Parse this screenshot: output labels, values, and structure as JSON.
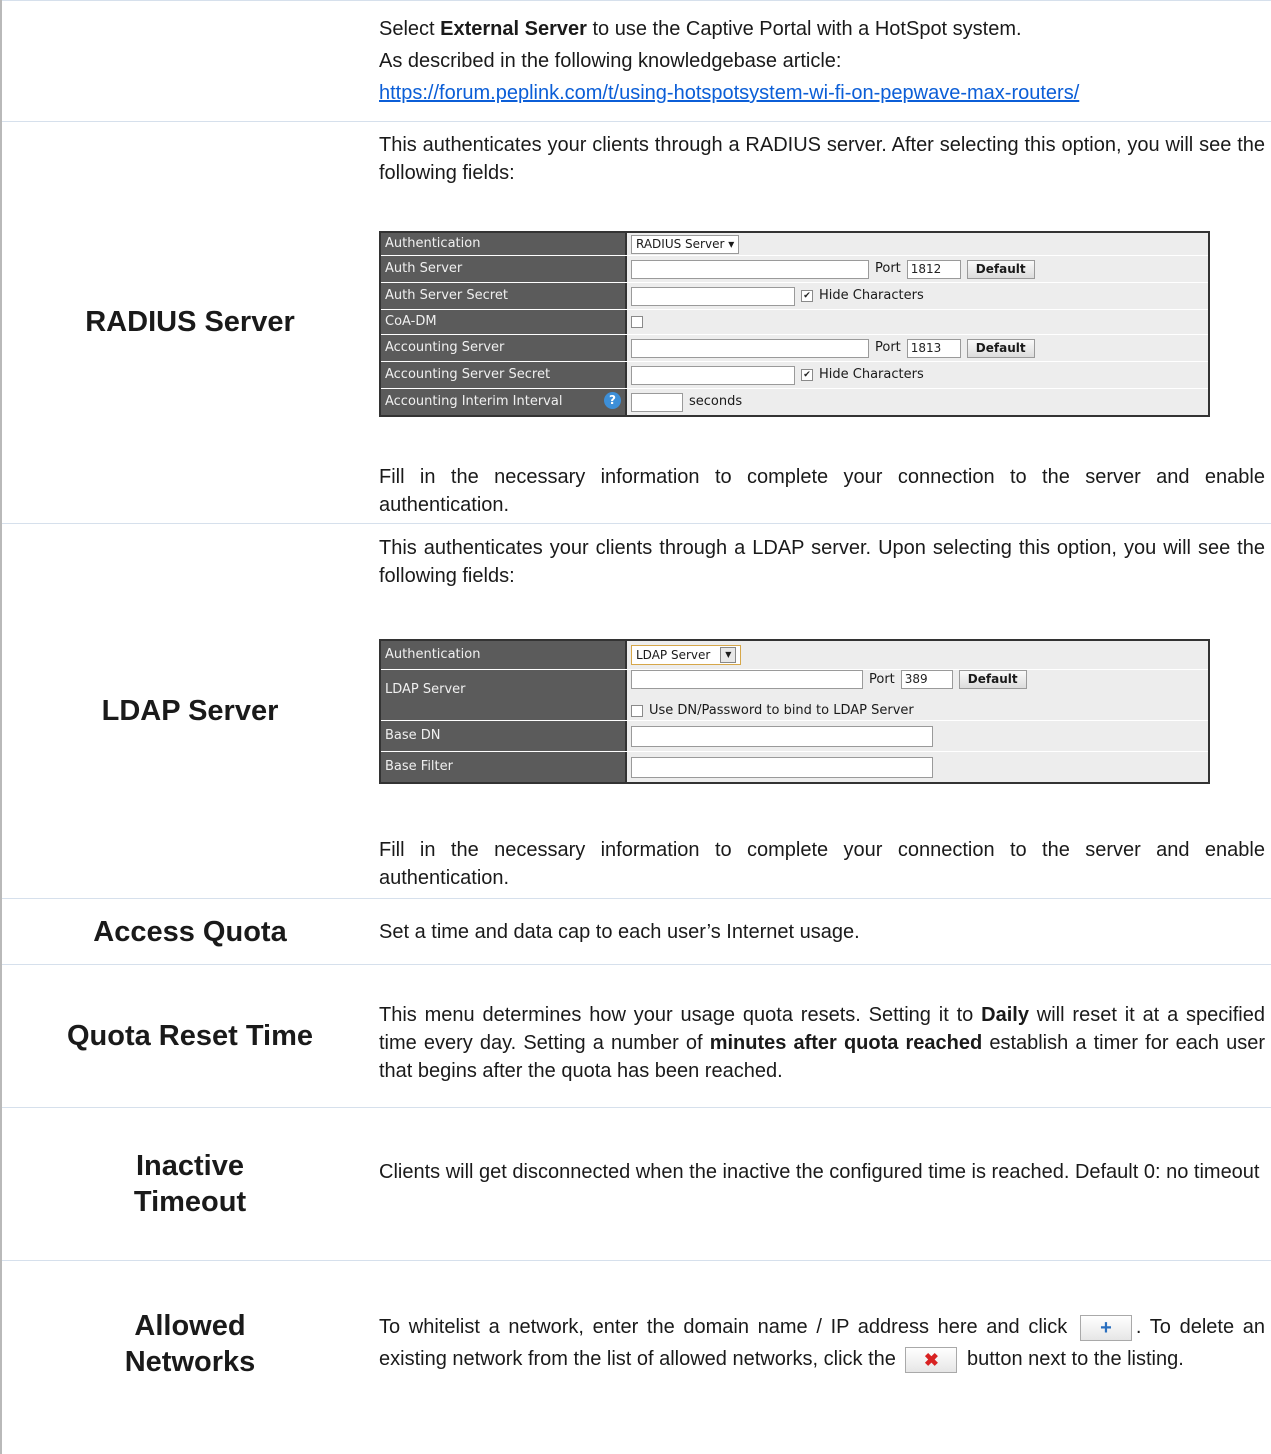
{
  "external": {
    "line1_pre": "Select ",
    "line1_bold": "External Server",
    "line1_post": " to use the Captive Portal with a HotSpot system.",
    "line2": "As described in the following knowledgebase article:",
    "link": "https://forum.peplink.com/t/using-hotspotsystem-wi-fi-on-pepwave-max-routers/"
  },
  "radius": {
    "label": "RADIUS Server",
    "intro": "This authenticates your clients through a RADIUS server. After selecting this option, you will see the following fields:",
    "outro": "Fill in the necessary information to complete your connection to the server and enable authentication.",
    "table": {
      "authentication_label": "Authentication",
      "authentication_value": "RADIUS Server",
      "auth_server_label": "Auth Server",
      "port_label": "Port",
      "auth_port": "1812",
      "default_label": "Default",
      "auth_secret_label": "Auth Server Secret",
      "hide_chars": "Hide Characters",
      "coa_label": "CoA-DM",
      "acct_server_label": "Accounting Server",
      "acct_port": "1813",
      "acct_secret_label": "Accounting Server Secret",
      "interim_label": "Accounting Interim Interval",
      "seconds": "seconds"
    }
  },
  "ldap": {
    "label": "LDAP Server",
    "intro": "This authenticates your clients through a LDAP server. Upon selecting this option, you will see the following fields:",
    "outro": "Fill in the necessary information to complete your connection to the server and enable authentication.",
    "table": {
      "authentication_label": "Authentication",
      "authentication_value": "LDAP Server",
      "ldap_server_label": "LDAP Server",
      "port_label": "Port",
      "port": "389",
      "default_label": "Default",
      "bind_label": "Use DN/Password to bind to LDAP Server",
      "base_dn_label": "Base DN",
      "base_filter_label": "Base Filter"
    }
  },
  "quota": {
    "label": "Access Quota",
    "text": "Set a time and data cap to each user’s Internet usage."
  },
  "reset": {
    "label": "Quota Reset Time",
    "t1": "This menu determines how your usage quota resets. Setting it to ",
    "b1": "Daily",
    "t2": " will reset it at a specified time every day. Setting a number of ",
    "b2": "minutes after quota reached",
    "t3": " establish a timer for each user that begins after the quota has been reached."
  },
  "inactive": {
    "label": "Inactive Timeout",
    "text": "Clients will get disconnected when the inactive the configured time is reached. Default 0: no timeout"
  },
  "allowed": {
    "label": "Allowed Networks",
    "t1": "To whitelist a network, enter the domain name / IP address here and click",
    "t2": ". To delete an existing network from the list of allowed networks, click the",
    "t3": "button next to the listing.",
    "plus_icon": "+",
    "x_icon": "✖"
  }
}
